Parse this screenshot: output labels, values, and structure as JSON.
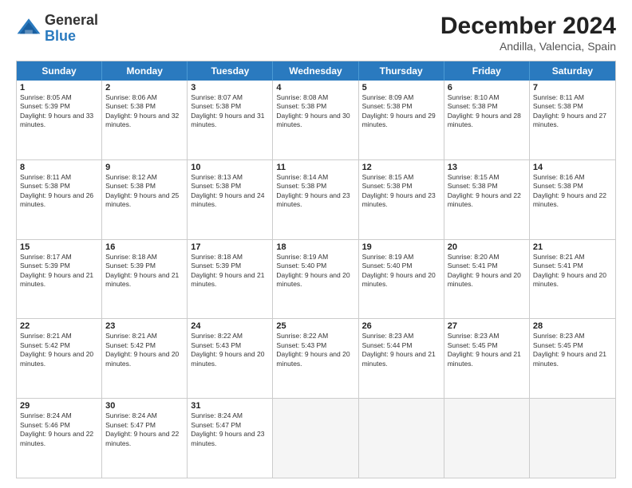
{
  "header": {
    "logo_general": "General",
    "logo_blue": "Blue",
    "title": "December 2024",
    "subtitle": "Andilla, Valencia, Spain"
  },
  "days_of_week": [
    "Sunday",
    "Monday",
    "Tuesday",
    "Wednesday",
    "Thursday",
    "Friday",
    "Saturday"
  ],
  "weeks": [
    [
      {
        "day": 1,
        "sunrise": "8:05 AM",
        "sunset": "5:39 PM",
        "daylight": "9 hours and 33 minutes"
      },
      {
        "day": 2,
        "sunrise": "8:06 AM",
        "sunset": "5:38 PM",
        "daylight": "9 hours and 32 minutes"
      },
      {
        "day": 3,
        "sunrise": "8:07 AM",
        "sunset": "5:38 PM",
        "daylight": "9 hours and 31 minutes"
      },
      {
        "day": 4,
        "sunrise": "8:08 AM",
        "sunset": "5:38 PM",
        "daylight": "9 hours and 30 minutes"
      },
      {
        "day": 5,
        "sunrise": "8:09 AM",
        "sunset": "5:38 PM",
        "daylight": "9 hours and 29 minutes"
      },
      {
        "day": 6,
        "sunrise": "8:10 AM",
        "sunset": "5:38 PM",
        "daylight": "9 hours and 28 minutes"
      },
      {
        "day": 7,
        "sunrise": "8:11 AM",
        "sunset": "5:38 PM",
        "daylight": "9 hours and 27 minutes"
      }
    ],
    [
      {
        "day": 8,
        "sunrise": "8:11 AM",
        "sunset": "5:38 PM",
        "daylight": "9 hours and 26 minutes"
      },
      {
        "day": 9,
        "sunrise": "8:12 AM",
        "sunset": "5:38 PM",
        "daylight": "9 hours and 25 minutes"
      },
      {
        "day": 10,
        "sunrise": "8:13 AM",
        "sunset": "5:38 PM",
        "daylight": "9 hours and 24 minutes"
      },
      {
        "day": 11,
        "sunrise": "8:14 AM",
        "sunset": "5:38 PM",
        "daylight": "9 hours and 23 minutes"
      },
      {
        "day": 12,
        "sunrise": "8:15 AM",
        "sunset": "5:38 PM",
        "daylight": "9 hours and 23 minutes"
      },
      {
        "day": 13,
        "sunrise": "8:15 AM",
        "sunset": "5:38 PM",
        "daylight": "9 hours and 22 minutes"
      },
      {
        "day": 14,
        "sunrise": "8:16 AM",
        "sunset": "5:38 PM",
        "daylight": "9 hours and 22 minutes"
      }
    ],
    [
      {
        "day": 15,
        "sunrise": "8:17 AM",
        "sunset": "5:39 PM",
        "daylight": "9 hours and 21 minutes"
      },
      {
        "day": 16,
        "sunrise": "8:18 AM",
        "sunset": "5:39 PM",
        "daylight": "9 hours and 21 minutes"
      },
      {
        "day": 17,
        "sunrise": "8:18 AM",
        "sunset": "5:39 PM",
        "daylight": "9 hours and 21 minutes"
      },
      {
        "day": 18,
        "sunrise": "8:19 AM",
        "sunset": "5:40 PM",
        "daylight": "9 hours and 20 minutes"
      },
      {
        "day": 19,
        "sunrise": "8:19 AM",
        "sunset": "5:40 PM",
        "daylight": "9 hours and 20 minutes"
      },
      {
        "day": 20,
        "sunrise": "8:20 AM",
        "sunset": "5:41 PM",
        "daylight": "9 hours and 20 minutes"
      },
      {
        "day": 21,
        "sunrise": "8:21 AM",
        "sunset": "5:41 PM",
        "daylight": "9 hours and 20 minutes"
      }
    ],
    [
      {
        "day": 22,
        "sunrise": "8:21 AM",
        "sunset": "5:42 PM",
        "daylight": "9 hours and 20 minutes"
      },
      {
        "day": 23,
        "sunrise": "8:21 AM",
        "sunset": "5:42 PM",
        "daylight": "9 hours and 20 minutes"
      },
      {
        "day": 24,
        "sunrise": "8:22 AM",
        "sunset": "5:43 PM",
        "daylight": "9 hours and 20 minutes"
      },
      {
        "day": 25,
        "sunrise": "8:22 AM",
        "sunset": "5:43 PM",
        "daylight": "9 hours and 20 minutes"
      },
      {
        "day": 26,
        "sunrise": "8:23 AM",
        "sunset": "5:44 PM",
        "daylight": "9 hours and 21 minutes"
      },
      {
        "day": 27,
        "sunrise": "8:23 AM",
        "sunset": "5:45 PM",
        "daylight": "9 hours and 21 minutes"
      },
      {
        "day": 28,
        "sunrise": "8:23 AM",
        "sunset": "5:45 PM",
        "daylight": "9 hours and 21 minutes"
      }
    ],
    [
      {
        "day": 29,
        "sunrise": "8:24 AM",
        "sunset": "5:46 PM",
        "daylight": "9 hours and 22 minutes"
      },
      {
        "day": 30,
        "sunrise": "8:24 AM",
        "sunset": "5:47 PM",
        "daylight": "9 hours and 22 minutes"
      },
      {
        "day": 31,
        "sunrise": "8:24 AM",
        "sunset": "5:47 PM",
        "daylight": "9 hours and 23 minutes"
      },
      null,
      null,
      null,
      null
    ]
  ]
}
